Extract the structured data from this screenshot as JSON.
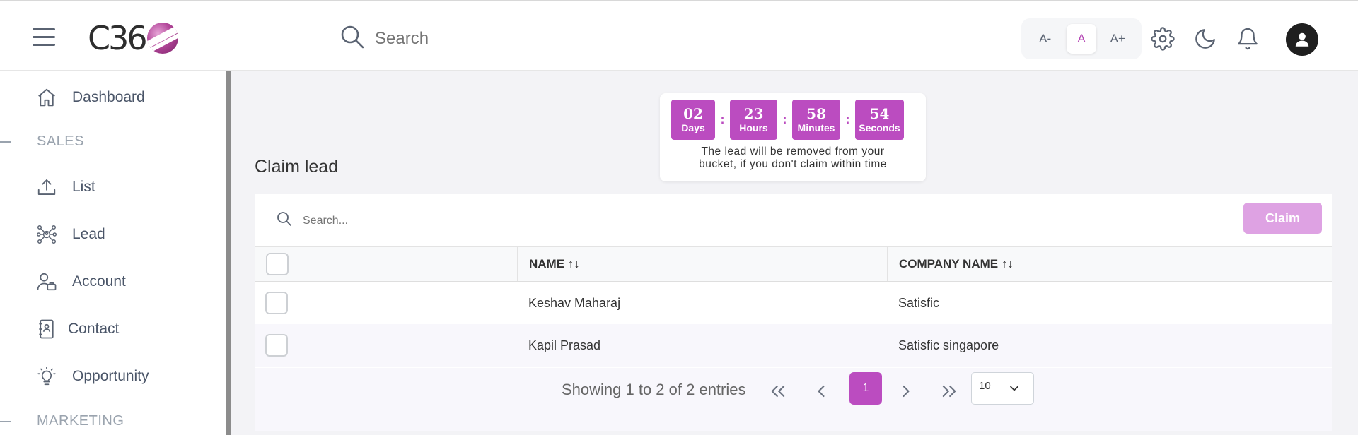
{
  "header": {
    "logo_text": "C36",
    "search": {
      "placeholder": "Search"
    },
    "font_size_buttons": [
      "A-",
      "A",
      "A+"
    ],
    "icons": [
      "menu-icon",
      "search-icon",
      "gear-icon",
      "moon-icon",
      "bell-icon",
      "user-avatar-icon"
    ]
  },
  "sidebar": {
    "items": [
      {
        "label": "Dashboard",
        "icon": "home-icon"
      },
      {
        "section": "SALES"
      },
      {
        "label": "List",
        "icon": "upload-icon"
      },
      {
        "label": "Lead",
        "icon": "network-icon"
      },
      {
        "label": "Account",
        "icon": "user-card-icon"
      },
      {
        "label": "Contact",
        "icon": "contact-book-icon"
      },
      {
        "label": "Opportunity",
        "icon": "lightbulb-icon"
      },
      {
        "section": "MARKETING"
      }
    ]
  },
  "countdown": {
    "days": "02",
    "days_label": "Days",
    "hours": "23",
    "hours_label": "Hours",
    "minutes": "58",
    "minutes_label": "Minutes",
    "seconds": "54",
    "seconds_label": "Seconds",
    "separator": ":",
    "note_line1": "The lead will be removed from your",
    "note_line2": "bucket, if you don't claim within time"
  },
  "main": {
    "title": "Claim lead",
    "table_search_placeholder": "Search...",
    "claim_label": "Claim",
    "columns": [
      "NAME ↑↓",
      "COMPANY NAME ↑↓"
    ],
    "rows": [
      {
        "name": "Keshav Maharaj",
        "company": "Satisfic"
      },
      {
        "name": "Kapil Prasad",
        "company": "Satisfic singapore"
      }
    ]
  },
  "pagination": {
    "entries_text": "Showing 1 to 2 of 2 entries",
    "current_page": "1",
    "page_size": "10"
  },
  "colors": {
    "accent": "#bb4cc0",
    "claim_disabled": "#dea2e3",
    "nav_text": "#4a5568",
    "section_text": "#9aa3ae"
  }
}
